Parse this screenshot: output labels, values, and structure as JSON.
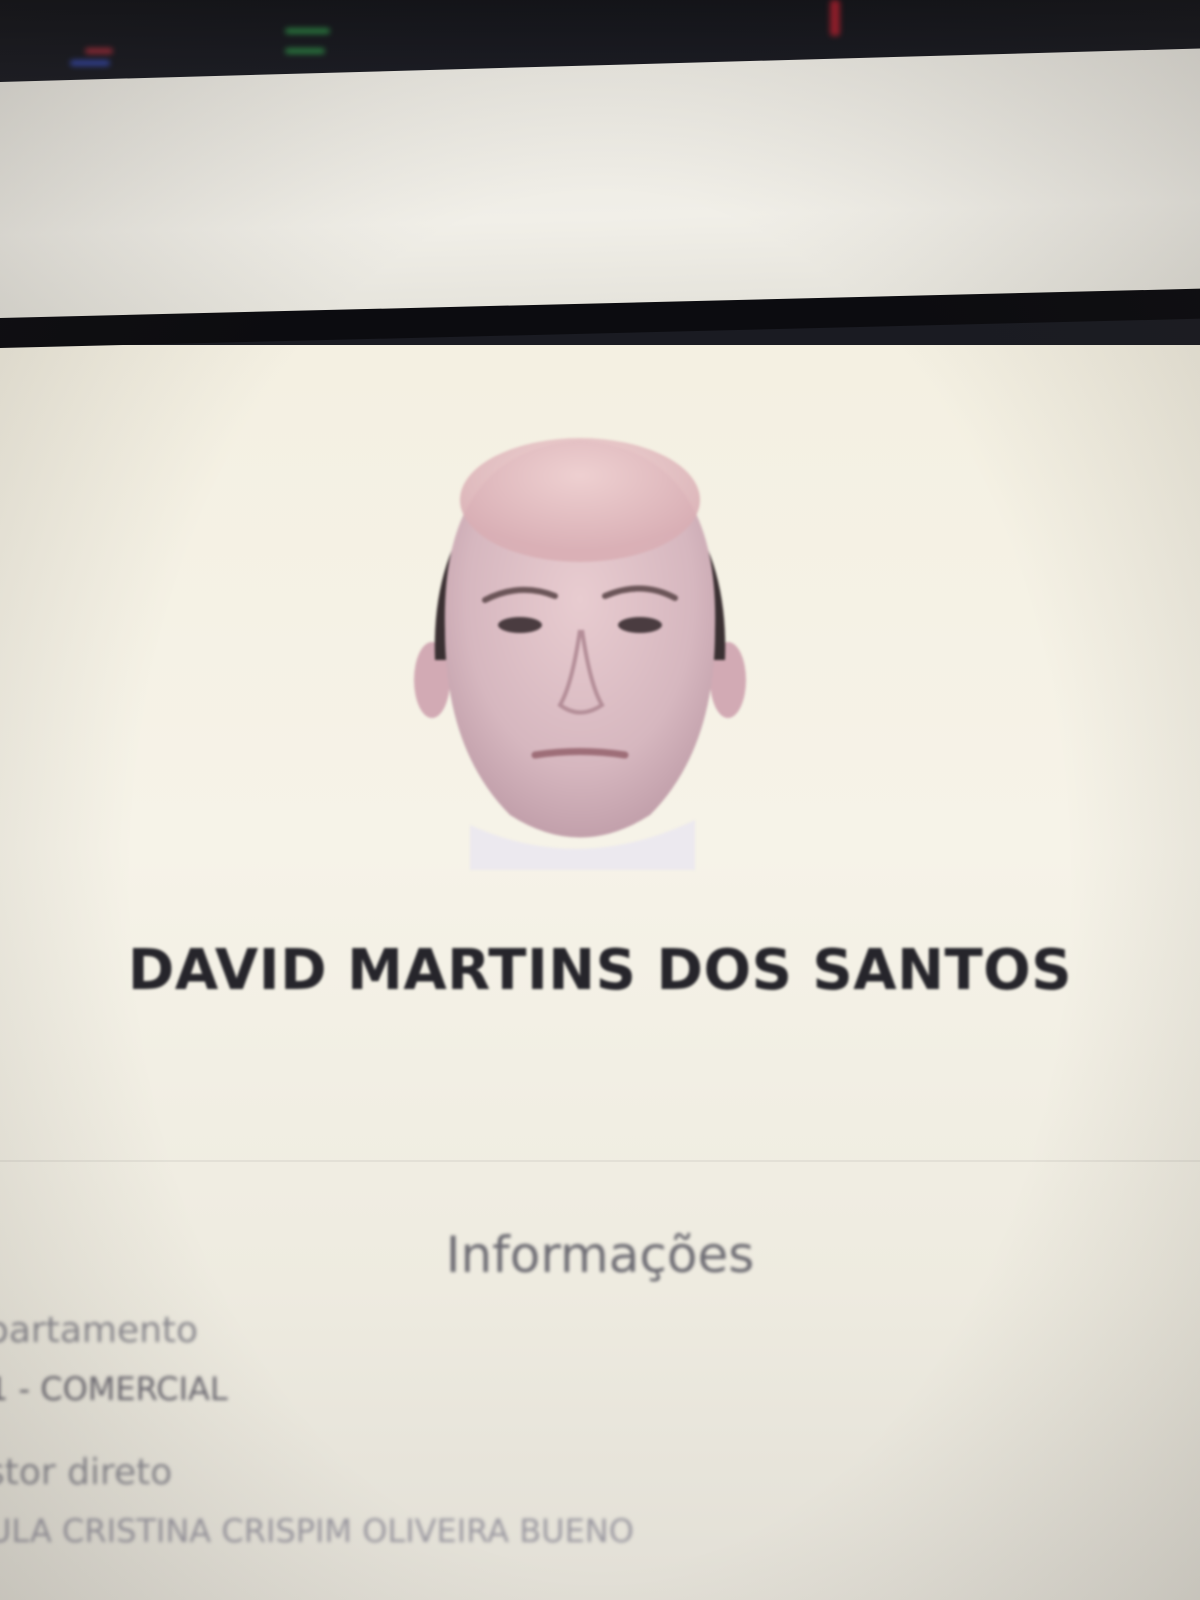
{
  "profile": {
    "name": "DAVID MARTINS DOS SANTOS",
    "photo": "employee-photo"
  },
  "info": {
    "title": "Informações",
    "fields": [
      {
        "label": "partamento",
        "value": "1 - COMERCIAL"
      },
      {
        "label": "stor direto",
        "value": "ULA CRISTINA CRISPIM OLIVEIRA BUENO"
      }
    ]
  },
  "colors": {
    "panel_background": "#f4f0e2",
    "name_text": "#26252b",
    "info_title_text": "#6d6c73",
    "divider": "#0c0c10"
  }
}
